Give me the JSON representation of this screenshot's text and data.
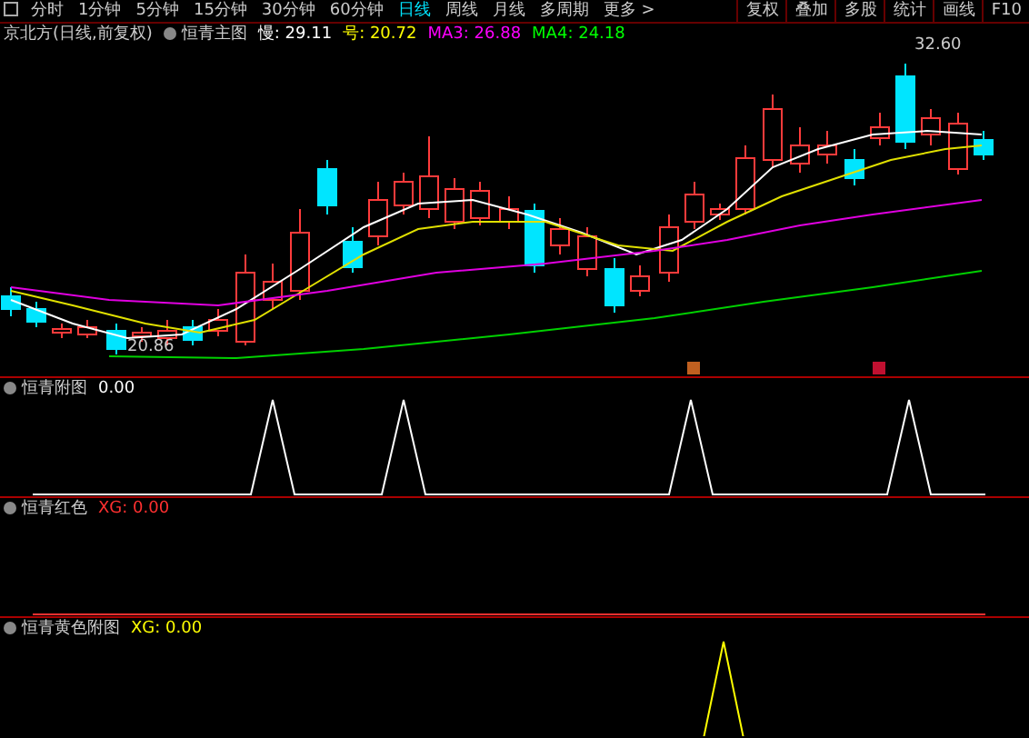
{
  "toolbar": {
    "tabs": [
      {
        "label": "分时",
        "selected": false
      },
      {
        "label": "1分钟",
        "selected": false
      },
      {
        "label": "5分钟",
        "selected": false
      },
      {
        "label": "15分钟",
        "selected": false
      },
      {
        "label": "30分钟",
        "selected": false
      },
      {
        "label": "60分钟",
        "selected": false
      },
      {
        "label": "日线",
        "selected": true
      },
      {
        "label": "周线",
        "selected": false
      },
      {
        "label": "月线",
        "selected": false
      },
      {
        "label": "多周期",
        "selected": false
      },
      {
        "label": "更多 >",
        "selected": false
      }
    ],
    "buttons": [
      "复权",
      "叠加",
      "多股",
      "统计",
      "画线",
      "F10"
    ]
  },
  "legend": {
    "title": "京北方(日线,前复权)",
    "indicator": "恒青主图",
    "values": [
      {
        "text": "慢: 29.11",
        "color": "#ffffff"
      },
      {
        "text": "号: 20.72",
        "color": "#ffff00"
      },
      {
        "text": "MA3: 26.88",
        "color": "#ff00ff"
      },
      {
        "text": "MA4: 24.18",
        "color": "#00ff00"
      }
    ]
  },
  "main_chart": {
    "high_label": "32.60",
    "low_label": "20.86"
  },
  "panels": [
    {
      "title": "恒青附图",
      "value": "0.00",
      "color": "#ffffff"
    },
    {
      "title": "恒青红色",
      "value": "XG: 0.00",
      "color": "#ff3030"
    },
    {
      "title": "恒青黄色附图",
      "value": "XG: 0.00",
      "color": "#ffff00"
    }
  ]
}
